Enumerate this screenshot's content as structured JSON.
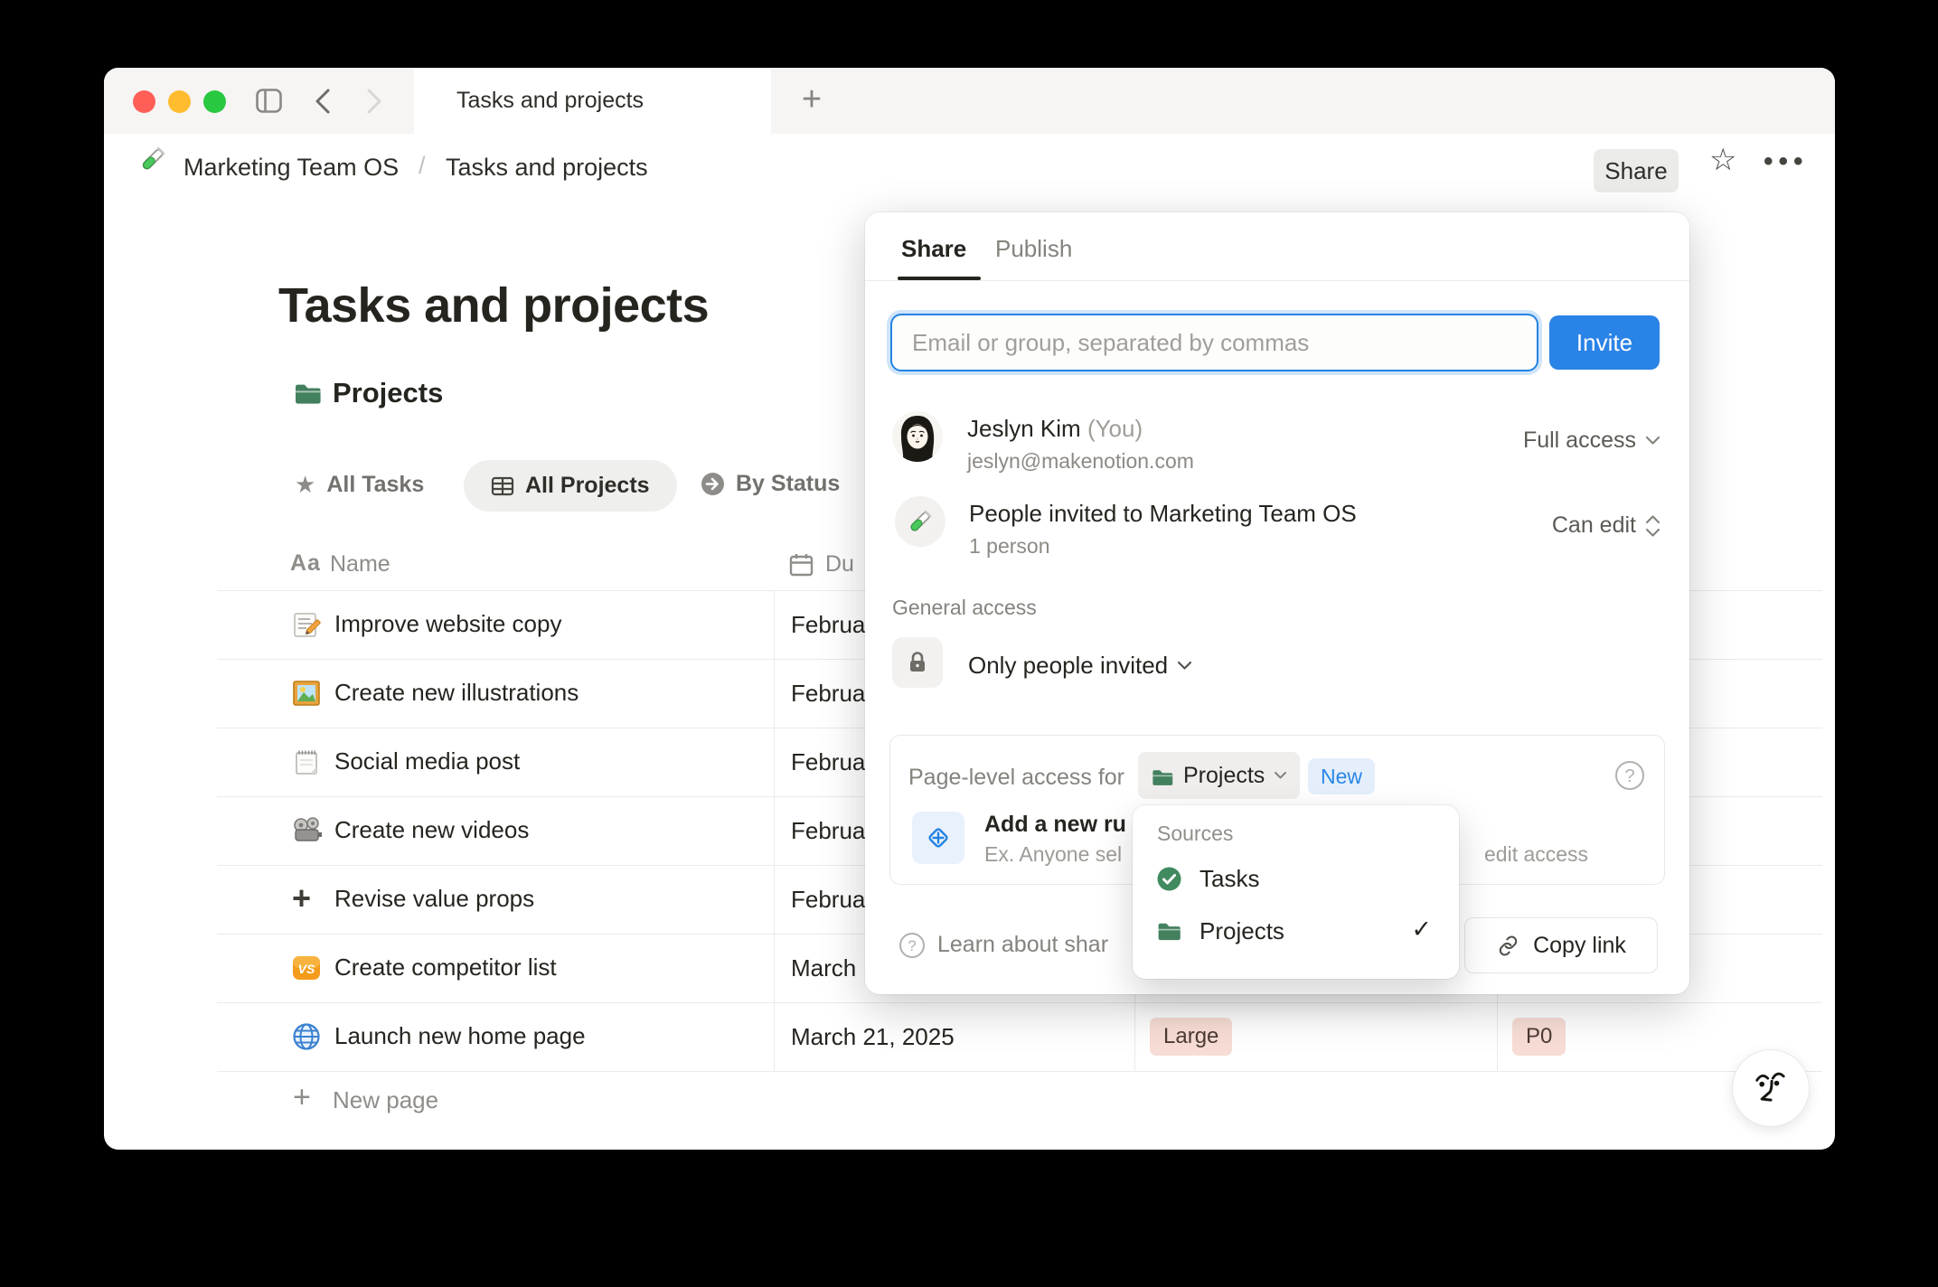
{
  "window": {
    "tab_title": "Tasks and projects",
    "plus_glyph": "+",
    "breadcrumb": {
      "workspace": "Marketing Team OS",
      "separator": "/",
      "page": "Tasks and projects"
    },
    "actions": {
      "share_label": "Share",
      "favorite_glyph": "☆",
      "more_glyph": "•••"
    }
  },
  "page": {
    "title": "Tasks and projects",
    "database_title": "Projects",
    "views": [
      {
        "label": "All Tasks",
        "star_glyph": "★"
      },
      {
        "label": "All Projects",
        "active": true
      },
      {
        "label": "By Status"
      }
    ],
    "table": {
      "header": {
        "name_type_glyph": "Aa",
        "name_label": "Name",
        "due_label": "Du"
      },
      "rows": [
        {
          "icon": "memo-icon",
          "name": "Improve website copy",
          "due": "Februa"
        },
        {
          "icon": "picture-icon",
          "name": "Create new illustrations",
          "due": "Februa"
        },
        {
          "icon": "notepad-icon",
          "name": "Social media post",
          "due": "Februa"
        },
        {
          "icon": "projector-icon",
          "name": "Create new videos",
          "due": "Februa"
        },
        {
          "icon": "plus-icon",
          "name": "Revise value props",
          "due": "Februa",
          "plus_glyph": "+"
        },
        {
          "icon": "vs-icon",
          "name": "Create competitor list",
          "due": "March"
        },
        {
          "icon": "globe-icon",
          "name": "Launch new home page",
          "due": "March 21, 2025",
          "size": "Large",
          "priority": "P0"
        }
      ],
      "new_page_label": "New page",
      "new_page_glyph": "+"
    }
  },
  "share_dialog": {
    "tabs": [
      {
        "label": "Share",
        "active": true
      },
      {
        "label": "Publish"
      }
    ],
    "invite": {
      "placeholder": "Email or group, separated by commas",
      "button_label": "Invite"
    },
    "people": [
      {
        "name": "Jeslyn Kim",
        "you_suffix": "(You)",
        "email": "jeslyn@makenotion.com",
        "access": "Full access"
      },
      {
        "name": "People invited to Marketing Team OS",
        "detail": "1 person",
        "access": "Can edit"
      }
    ],
    "general_access": {
      "label": "General access",
      "value": "Only people invited"
    },
    "page_level": {
      "prefix": "Page-level access for",
      "source": "Projects",
      "badge": "New",
      "help_glyph": "?",
      "rule_title": "Add a new ru",
      "rule_hint": "Ex. Anyone sel",
      "rule_hint_tail": "edit access"
    },
    "footer": {
      "help_glyph": "?",
      "learn_label": "Learn about shar",
      "copy_link_label": "Copy link"
    }
  },
  "sources_menu": {
    "title": "Sources",
    "items": [
      {
        "label": "Tasks"
      },
      {
        "label": "Projects",
        "checked": true
      }
    ],
    "check_glyph": "✓"
  },
  "colors": {
    "accent_blue": "#2383e2",
    "folder_green": "#43805e",
    "tag_red_bg": "#f7ddd5",
    "new_badge_bg": "#e4effb"
  }
}
